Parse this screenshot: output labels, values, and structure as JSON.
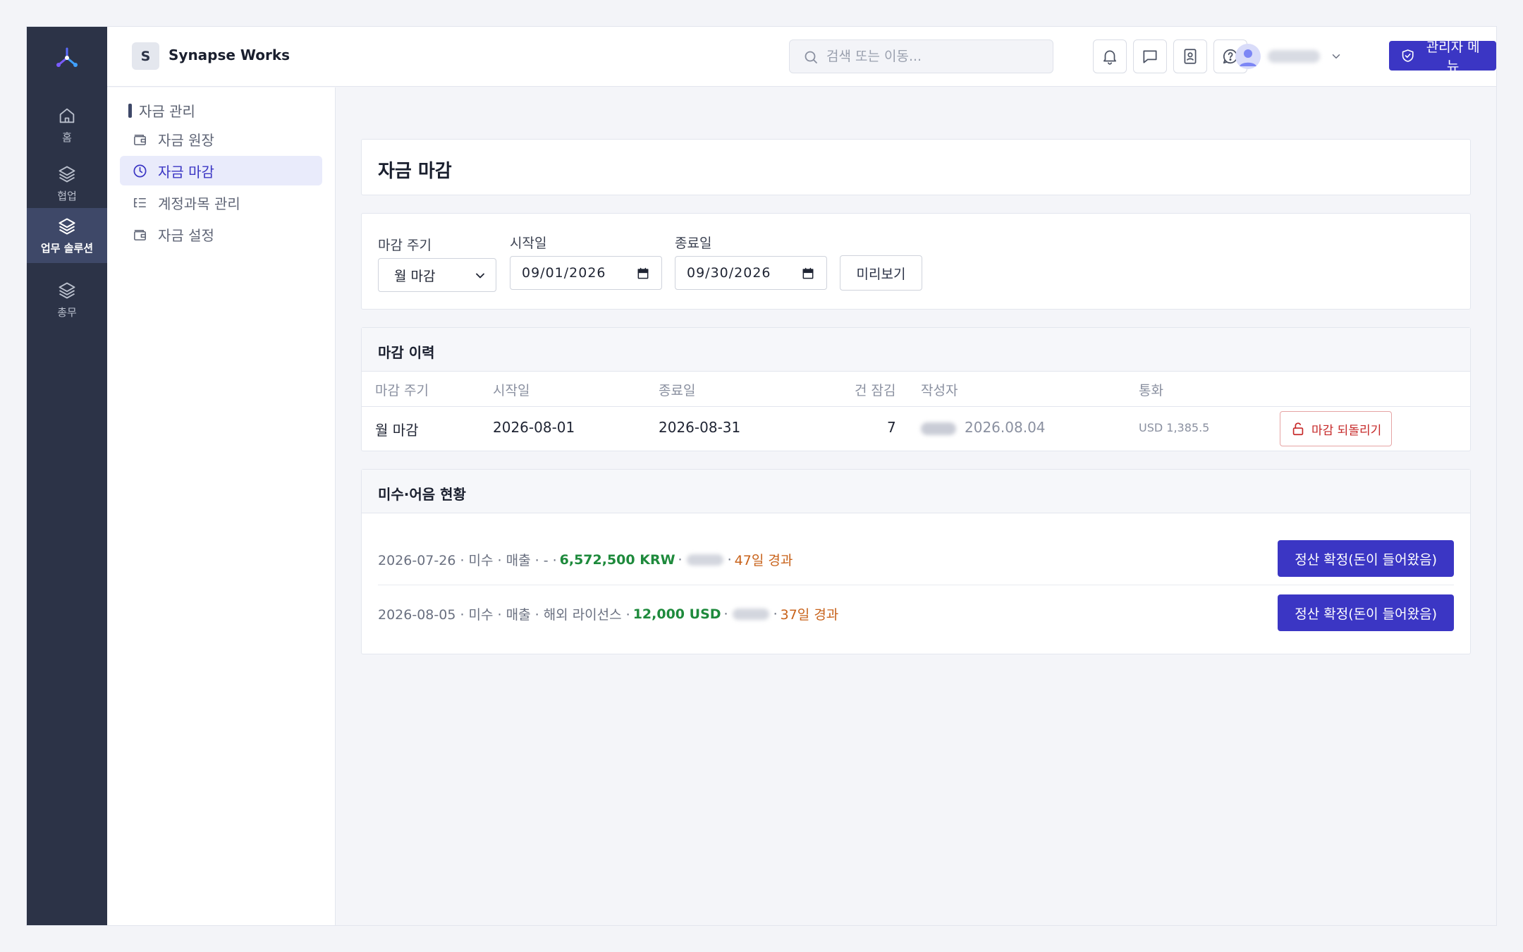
{
  "rail": {
    "items": [
      {
        "label": "홈",
        "icon": "home-icon"
      },
      {
        "label": "협업",
        "icon": "layers-icon"
      },
      {
        "label": "업무 솔루션",
        "icon": "layers-icon",
        "active": true
      },
      {
        "label": "총무",
        "icon": "layers-icon"
      }
    ]
  },
  "topbar": {
    "workspace_initial": "S",
    "workspace_name": "Synapse Works",
    "search_placeholder": "검색 또는 이동...",
    "admin_label": "관리자 메뉴"
  },
  "subnav": {
    "section_title": "자금 관리",
    "items": [
      {
        "label": "자금 원장",
        "icon": "wallet-icon"
      },
      {
        "label": "자금 마감",
        "icon": "clock-icon",
        "active": true
      },
      {
        "label": "계정과목 관리",
        "icon": "list-icon"
      },
      {
        "label": "자금 설정",
        "icon": "wallet-icon"
      }
    ]
  },
  "page": {
    "title": "자금 마감"
  },
  "filters": {
    "period_label": "마감 주기",
    "period_value": "월 마감",
    "start_label": "시작일",
    "start_value": "09/01/2026",
    "end_label": "종료일",
    "end_value": "09/30/2026",
    "preview_label": "미리보기"
  },
  "history": {
    "title": "마감 이력",
    "columns": [
      "마감 주기",
      "시작일",
      "종료일",
      "건 잠김",
      "작성자",
      "통화"
    ],
    "rows": [
      {
        "period": "월 마감",
        "start": "2026-08-01",
        "end": "2026-08-31",
        "locked": "7",
        "written_date": "2026.08.04",
        "currency": "USD 1,385.5",
        "action": "마감 되돌리기"
      }
    ]
  },
  "receivables": {
    "title": "미수·어음 현황",
    "rows": [
      {
        "prefix": "2026-07-26 · 미수 · 매출 · - ·",
        "amount": "6,572,500 KRW",
        "elapsed": "47일 경과",
        "action": "정산 확정(돈이 들어왔음)"
      },
      {
        "prefix": "2026-08-05 · 미수 · 매출 · 해외 라이선스 ·",
        "amount": "12,000 USD",
        "elapsed": "37일 경과",
        "action": "정산 확정(돈이 들어왔음)"
      }
    ]
  },
  "colors": {
    "primary": "#3b36c4",
    "rail_bg": "#2c3347",
    "amount_green": "#1e8a3c",
    "elapsed_orange": "#c8621a",
    "danger": "#c62828"
  }
}
